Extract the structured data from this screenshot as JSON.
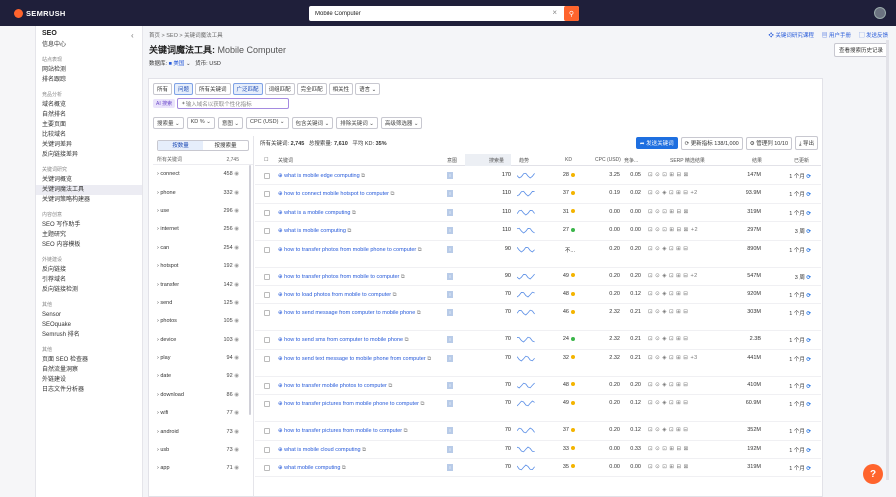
{
  "app": {
    "logo": "SEMRUSH",
    "search_value": "Mobile Computer"
  },
  "rail": [
    {
      "icon": "⌂",
      "label": "首页"
    },
    {
      "icon": "⊚",
      "label": "SEO",
      "active": true
    },
    {
      "icon": "▥",
      "label": "流量与市场"
    },
    {
      "icon": "◎",
      "label": "广告"
    },
    {
      "icon": "✦",
      "label": "AI"
    },
    {
      "icon": "⚲",
      "label": "本地"
    },
    {
      "icon": "✎",
      "label": "内容"
    },
    {
      "icon": "◈",
      "label": "社交"
    },
    {
      "icon": "⚡",
      "label": "AI 以关"
    },
    {
      "icon": "▤",
      "label": "报告"
    },
    {
      "icon": "▦",
      "label": "App Center"
    }
  ],
  "nav": {
    "heading": "SEO",
    "dashboard": "信息中心",
    "sections": [
      {
        "title": "站点表现",
        "links": [
          "网站检测",
          "排名跟踪"
        ]
      },
      {
        "title": "竞品分析",
        "links": [
          "域名概览",
          "自然排名",
          "主要页面",
          "比较域名",
          "关键词差异",
          "反向链接差异"
        ]
      },
      {
        "title": "关键词研究",
        "links": [
          "关键词概览",
          "关键词魔法工具",
          "关键词策略构建器"
        ]
      },
      {
        "title": "内容创意",
        "links": [
          "SEO 写作助手",
          "主题研究",
          "SEO 内容模板"
        ]
      },
      {
        "title": "外链建设",
        "links": [
          "反向链接",
          "引荐域名",
          "反向链接检测"
        ]
      },
      {
        "title": "其他",
        "links": [
          "Sensor",
          "SEOquake",
          "Semrush 排名"
        ]
      },
      {
        "title": "其他",
        "links": [
          "页面 SEO 检查器",
          "自然流量洞察",
          "外链建设",
          "日志文件分析器"
        ]
      }
    ]
  },
  "breadcrumb": "首页  >  SEO  >  关键词魔法工具",
  "title": {
    "tool": "关键词魔法工具:",
    "keyword": "Mobile Computer"
  },
  "meta": {
    "db_label": "数据库:",
    "db": "■ 美国",
    "cur_label": "货币:",
    "cur": "USD"
  },
  "top_links": [
    "关键词研究课程",
    "用户手册",
    "发送反馈"
  ],
  "view_history": "查看搜索历史记录",
  "chips": [
    "所有",
    "问题",
    "所有关键词",
    "广泛匹配",
    "词组匹配",
    "完全匹配",
    "相关性",
    "语言 ⌄"
  ],
  "ai": {
    "badge": "AI 搜索",
    "placeholder": "输入域名以获取个性化指标"
  },
  "filters": [
    "搜索量 ⌄",
    "KD % ⌄",
    "意图 ⌄",
    "CPC (USD) ⌄",
    "包含关键词 ⌄",
    "排除关键词 ⌄",
    "高级筛选器 ⌄"
  ],
  "left": {
    "seg": [
      "按数量",
      "按搜索量"
    ],
    "head_kw": "所有关键词",
    "head_cnt": "2,745",
    "groups": [
      [
        "connect",
        "458"
      ],
      [
        "phone",
        "332"
      ],
      [
        "use",
        "296"
      ],
      [
        "internet",
        "256"
      ],
      [
        "can",
        "254"
      ],
      [
        "hotspot",
        "192"
      ],
      [
        "transfer",
        "142"
      ],
      [
        "send",
        "125"
      ],
      [
        "photos",
        "105"
      ],
      [
        "device",
        "103"
      ],
      [
        "play",
        "94"
      ],
      [
        "date",
        "92"
      ],
      [
        "download",
        "86"
      ],
      [
        "wifi",
        "77"
      ],
      [
        "android",
        "73"
      ],
      [
        "usb",
        "73"
      ],
      [
        "app",
        "71"
      ]
    ]
  },
  "summary": {
    "all_kw": "所有关键词:",
    "all_kw_v": "2,745",
    "vol": "总搜索量:",
    "vol_v": "7,610",
    "kd": "平均 KD:",
    "kd_v": "35%"
  },
  "actions": {
    "send": "发送关键词",
    "refresh": "更新指标",
    "refresh_n": "138/1,000",
    "manage": "管理列",
    "manage_n": "10/10",
    "export": "导出"
  },
  "cols": [
    "关键词",
    "意图",
    "搜索量",
    "趋势",
    "KD",
    "CPC (USD)",
    "竞争...",
    "SERP 精选结果",
    "结果",
    "已更新"
  ],
  "rows": [
    {
      "kw": "what is mobile edge computing",
      "vol": "170",
      "kd": "28",
      "kdc": "#f4b400",
      "cpc": "3.25",
      "com": "0.05",
      "serp": "⊡ ⊙ ⊡ ⊞ ⊟ ⊠",
      "res": "147M",
      "upd": "1 个月"
    },
    {
      "kw": "how to connect mobile hotspot to computer",
      "vol": "110",
      "kd": "37",
      "kdc": "#f4b400",
      "cpc": "0.19",
      "com": "0.02",
      "serp": "⊡ ⊙ ◈ ⊡ ⊞ ⊟ +2",
      "res": "93.9M",
      "upd": "1 个月"
    },
    {
      "kw": "what is a mobile computing",
      "vol": "110",
      "kd": "31",
      "kdc": "#f4b400",
      "cpc": "0.00",
      "com": "0.00",
      "serp": "⊡ ⊙ ⊡ ⊞ ⊟ ⊠",
      "res": "319M",
      "upd": "1 个月"
    },
    {
      "kw": "what is mobile computing",
      "vol": "110",
      "kd": "27",
      "kdc": "#3bb54a",
      "cpc": "0.00",
      "com": "0.00",
      "serp": "⊡ ⊙ ⊡ ⊞ ⊟ ⊠ +2",
      "res": "297M",
      "upd": "3 周"
    },
    {
      "kw": "how to transfer photos from mobile phone to computer",
      "vol": "90",
      "kd": "不...",
      "kdc": "",
      "cpc": "0.20",
      "com": "0.20",
      "serp": "⊡ ⊙ ◈ ⊡ ⊞ ⊟",
      "res": "890M",
      "upd": "1 个月",
      "tall": true
    },
    {
      "kw": "how to transfer photos from mobile to computer",
      "vol": "90",
      "kd": "49",
      "kdc": "#f4b400",
      "cpc": "0.20",
      "com": "0.20",
      "serp": "⊡ ⊙ ◈ ⊡ ⊞ ⊟ +2",
      "res": "547M",
      "upd": "3 周"
    },
    {
      "kw": "how to load photos from mobile to computer",
      "vol": "70",
      "kd": "48",
      "kdc": "#f4b400",
      "cpc": "0.20",
      "com": "0.12",
      "serp": "⊡ ⊙ ◈ ⊡ ⊞ ⊟",
      "res": "920M",
      "upd": "1 个月"
    },
    {
      "kw": "how to send message from computer to mobile phone",
      "vol": "70",
      "kd": "46",
      "kdc": "#f4b400",
      "cpc": "2.32",
      "com": "0.21",
      "serp": "⊡ ⊙ ◈ ⊡ ⊞ ⊟",
      "res": "303M",
      "upd": "1 个月",
      "tall": true
    },
    {
      "kw": "how to send sms from computer to mobile phone",
      "vol": "70",
      "kd": "24",
      "kdc": "#3bb54a",
      "cpc": "2.32",
      "com": "0.21",
      "serp": "⊡ ⊙ ◈ ⊡ ⊞ ⊟",
      "res": "2.3B",
      "upd": "1 个月"
    },
    {
      "kw": "how to send text message to mobile phone from computer",
      "vol": "70",
      "kd": "32",
      "kdc": "#f4b400",
      "cpc": "2.32",
      "com": "0.21",
      "serp": "⊡ ⊙ ◈ ⊡ ⊞ ⊟ +3",
      "res": "441M",
      "upd": "1 个月",
      "tall": true
    },
    {
      "kw": "how to transfer mobile photos to computer",
      "vol": "70",
      "kd": "48",
      "kdc": "#f4b400",
      "cpc": "0.20",
      "com": "0.20",
      "serp": "⊡ ⊙ ◈ ⊡ ⊞ ⊟",
      "res": "410M",
      "upd": "1 个月"
    },
    {
      "kw": "how to transfer pictures from mobile phone to computer",
      "vol": "70",
      "kd": "49",
      "kdc": "#f4b400",
      "cpc": "0.20",
      "com": "0.12",
      "serp": "⊡ ⊙ ◈ ⊡ ⊞ ⊟",
      "res": "60.9M",
      "upd": "1 个月",
      "tall": true
    },
    {
      "kw": "how to transfer pictures from mobile to computer",
      "vol": "70",
      "kd": "37",
      "kdc": "#f4b400",
      "cpc": "0.20",
      "com": "0.12",
      "serp": "⊡ ⊙ ◈ ⊡ ⊞ ⊟",
      "res": "352M",
      "upd": "1 个月"
    },
    {
      "kw": "what is mobile cloud computing",
      "vol": "70",
      "kd": "33",
      "kdc": "#f4b400",
      "cpc": "0.00",
      "com": "0.33",
      "serp": "⊡ ⊙ ⊡ ⊞ ⊟ ⊠",
      "res": "192M",
      "upd": "1 个月"
    },
    {
      "kw": "what mobile computing",
      "vol": "70",
      "kd": "35",
      "kdc": "#f4b400",
      "cpc": "0.00",
      "com": "0.00",
      "serp": "⊡ ⊙ ⊡ ⊞ ⊟ ⊠",
      "res": "319M",
      "upd": "1 个月"
    }
  ]
}
